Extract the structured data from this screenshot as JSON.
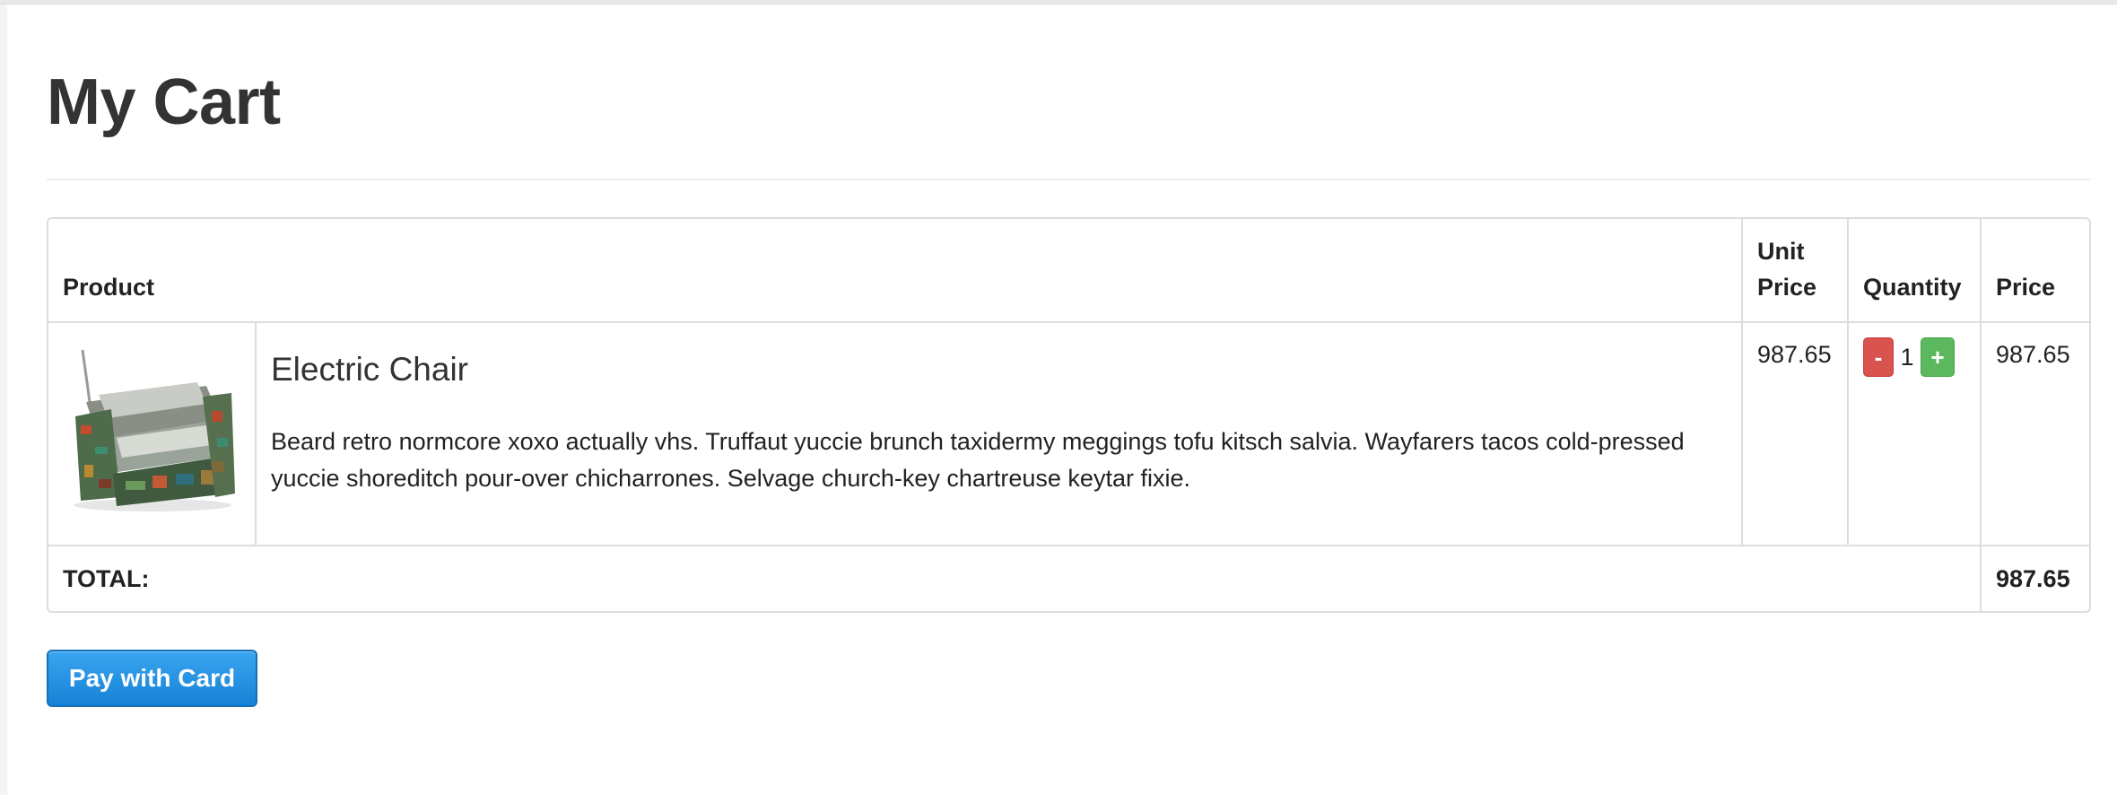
{
  "page": {
    "title": "My Cart"
  },
  "table": {
    "headers": {
      "product": "Product",
      "unit_price": "Unit Price",
      "quantity": "Quantity",
      "price": "Price"
    },
    "items": [
      {
        "name": "Electric Chair",
        "description": "Beard retro normcore xoxo actually vhs. Truffaut yuccie brunch taxidermy meggings tofu kitsch salvia. Wayfarers tacos cold-pressed yuccie shoreditch pour-over chicharrones. Selvage church-key chartreuse keytar fixie.",
        "image_alt": "Electric Chair",
        "unit_price": "987.65",
        "quantity": "1",
        "decrement_label": "-",
        "increment_label": "+",
        "price": "987.65"
      }
    ],
    "total_label": "TOTAL:",
    "total_value": "987.65"
  },
  "actions": {
    "pay_label": "Pay with Card"
  },
  "colors": {
    "decrement_button": "#d9534f",
    "increment_button": "#5cb85c",
    "pay_button": "#1682d6"
  }
}
